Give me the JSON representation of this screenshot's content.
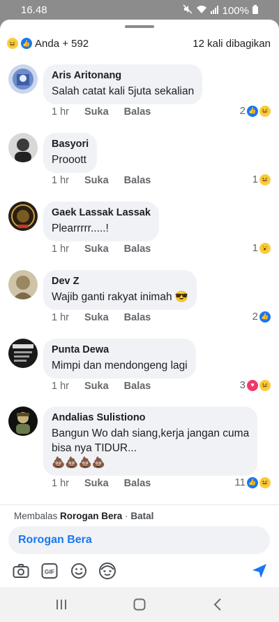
{
  "status": {
    "time": "16.48",
    "battery": "100%"
  },
  "header": {
    "reactors": "Anda + 592",
    "shares": "12 kali dibagikan"
  },
  "comments": [
    {
      "name": "Aris Aritonang",
      "text": "Salah catat kali 5juta sekalian",
      "time": "1 hr",
      "like": "Suka",
      "reply": "Balas",
      "count": "2",
      "reactions": [
        "like",
        "haha"
      ]
    },
    {
      "name": "Basyori",
      "text": "Prooott",
      "time": "1 hr",
      "like": "Suka",
      "reply": "Balas",
      "count": "1",
      "reactions": [
        "haha"
      ]
    },
    {
      "name": "Gaek Lassak Lassak",
      "text": "Plearrrrr.....!",
      "time": "1 hr",
      "like": "Suka",
      "reply": "Balas",
      "count": "1",
      "reactions": [
        "wow"
      ]
    },
    {
      "name": "Dev Z",
      "text": "Wajib ganti rakyat inimah 😎",
      "time": "1 hr",
      "like": "Suka",
      "reply": "Balas",
      "count": "2",
      "reactions": [
        "like"
      ]
    },
    {
      "name": "Punta Dewa",
      "text": "Mimpi dan mendongeng lagi",
      "time": "1 hr",
      "like": "Suka",
      "reply": "Balas",
      "count": "3",
      "reactions": [
        "love",
        "haha"
      ]
    },
    {
      "name": "Andalias Sulistiono",
      "text": "Bangun Wo dah siang,kerja jangan cuma",
      "text2": "bisa nya TIDUR...",
      "text3": "💩💩💩💩",
      "time": "1 hr",
      "like": "Suka",
      "reply": "Balas",
      "count": "11",
      "reactions": [
        "like",
        "haha"
      ]
    }
  ],
  "reply": {
    "prefix": "Membalas",
    "target": "Rorogan Bera",
    "separator": " · ",
    "cancel": "Batal",
    "input_value": "Rorogan Bera"
  },
  "toolbar": {
    "icons": [
      "camera-icon",
      "gif-icon",
      "emoji-icon",
      "avatar-sticker-icon",
      "send-icon"
    ]
  },
  "colors": {
    "accent": "#1877f2",
    "bubble": "#f0f2f5",
    "muted": "#65676b"
  }
}
